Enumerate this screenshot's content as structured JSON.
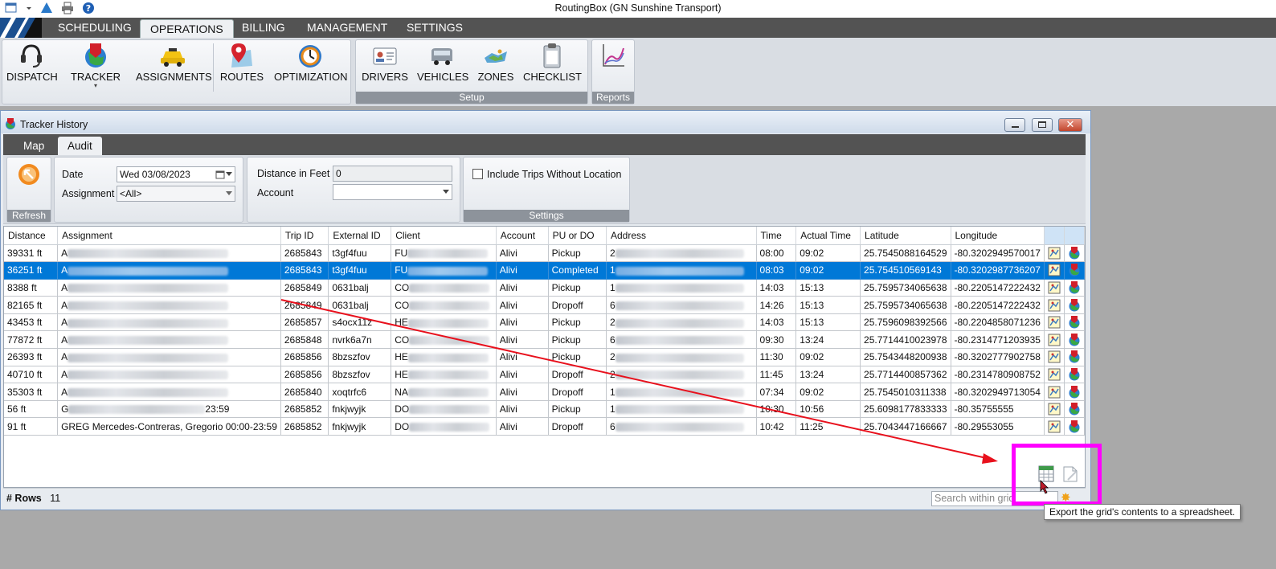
{
  "app": {
    "title": "RoutingBox (GN Sunshine Transport)"
  },
  "ribbon_tabs": [
    "SCHEDULING",
    "OPERATIONS",
    "BILLING",
    "MANAGEMENT",
    "SETTINGS"
  ],
  "ribbon": {
    "buttons": {
      "dispatch": "DISPATCH",
      "tracker": "TRACKER",
      "assignments": "ASSIGNMENTS",
      "routes": "ROUTES",
      "optimization": "OPTIMIZATION",
      "drivers": "DRIVERS",
      "vehicles": "VEHICLES",
      "zones": "ZONES",
      "checklist": "CHECKLIST"
    },
    "groups": {
      "setup": "Setup",
      "reports": "Reports"
    }
  },
  "window": {
    "title": "Tracker History",
    "tabs": [
      "Map",
      "Audit"
    ],
    "refresh_label": "Refresh",
    "settings_label": "Settings",
    "filters": {
      "date_label": "Date",
      "date_value": "Wed 03/08/2023",
      "assignment_label": "Assignment",
      "assignment_value": "<All>",
      "distance_label": "Distance in Feet",
      "distance_value": "0",
      "account_label": "Account",
      "account_value": "",
      "include_trips_label": "Include Trips Without Location"
    }
  },
  "grid": {
    "columns": [
      "Distance",
      "Assignment",
      "Trip ID",
      "External ID",
      "Client",
      "Account",
      "PU or DO",
      "Address",
      "Time",
      "Actual Time",
      "Latitude",
      "Longitude"
    ],
    "rows": [
      {
        "distance": "39331 ft",
        "assignment": "A",
        "trip_id": "2685843",
        "external_id": "t3gf4fuu",
        "client": "FU",
        "account": "Alivi",
        "pu_do": "Pickup",
        "address": "2",
        "time": "08:00",
        "actual_time": "09:02",
        "latitude": "25.7545088164529",
        "longitude": "-80.3202949570017"
      },
      {
        "distance": "36251 ft",
        "assignment": "A",
        "trip_id": "2685843",
        "external_id": "t3gf4fuu",
        "client": "FU",
        "account": "Alivi",
        "pu_do": "Completed",
        "address": "1",
        "time": "08:03",
        "actual_time": "09:02",
        "latitude": "25.754510569143",
        "longitude": "-80.3202987736207"
      },
      {
        "distance": "8388 ft",
        "assignment": "A",
        "trip_id": "2685849",
        "external_id": "0631balj",
        "client": "CO",
        "account": "Alivi",
        "pu_do": "Pickup",
        "address": "1",
        "time": "14:03",
        "actual_time": "15:13",
        "latitude": "25.7595734065638",
        "longitude": "-80.2205147222432"
      },
      {
        "distance": "82165 ft",
        "assignment": "A",
        "trip_id": "2685849",
        "external_id": "0631balj",
        "client": "CO",
        "account": "Alivi",
        "pu_do": "Dropoff",
        "address": "6",
        "time": "14:26",
        "actual_time": "15:13",
        "latitude": "25.7595734065638",
        "longitude": "-80.2205147222432"
      },
      {
        "distance": "43453 ft",
        "assignment": "A",
        "trip_id": "2685857",
        "external_id": "s4ocx11z",
        "client": "HE",
        "account": "Alivi",
        "pu_do": "Pickup",
        "address": "2",
        "time": "14:03",
        "actual_time": "15:13",
        "latitude": "25.7596098392566",
        "longitude": "-80.2204858071236"
      },
      {
        "distance": "77872 ft",
        "assignment": "A",
        "trip_id": "2685848",
        "external_id": "nvrk6a7n",
        "client": "CO",
        "account": "Alivi",
        "pu_do": "Pickup",
        "address": "6",
        "time": "09:30",
        "actual_time": "13:24",
        "latitude": "25.7714410023978",
        "longitude": "-80.2314771203935"
      },
      {
        "distance": "26393 ft",
        "assignment": "A",
        "trip_id": "2685856",
        "external_id": "8bzszfov",
        "client": "HE",
        "account": "Alivi",
        "pu_do": "Pickup",
        "address": "2",
        "time": "11:30",
        "actual_time": "09:02",
        "latitude": "25.7543448200938",
        "longitude": "-80.3202777902758"
      },
      {
        "distance": "40710 ft",
        "assignment": "A",
        "trip_id": "2685856",
        "external_id": "8bzszfov",
        "client": "HE",
        "account": "Alivi",
        "pu_do": "Dropoff",
        "address": "2",
        "time": "11:45",
        "actual_time": "13:24",
        "latitude": "25.7714400857362",
        "longitude": "-80.2314780908752"
      },
      {
        "distance": "35303 ft",
        "assignment": "A",
        "trip_id": "2685840",
        "external_id": "xoqtrfc6",
        "client": "NA",
        "account": "Alivi",
        "pu_do": "Dropoff",
        "address": "1",
        "time": "07:34",
        "actual_time": "09:02",
        "latitude": "25.7545010311338",
        "longitude": "-80.3202949713054"
      },
      {
        "distance": "56 ft",
        "assignment": "G",
        "assignment_suffix": "23:59",
        "trip_id": "2685852",
        "external_id": "fnkjwyjk",
        "client": "DO",
        "account": "Alivi",
        "pu_do": "Pickup",
        "address": "1",
        "time": "10:30",
        "actual_time": "10:56",
        "latitude": "25.6098177833333",
        "longitude": "-80.35755555"
      },
      {
        "distance": "91 ft",
        "assignment": "GREG Mercedes-Contreras, Gregorio 00:00-23:59",
        "trip_id": "2685852",
        "external_id": "fnkjwyjk",
        "client": "DO",
        "account": "Alivi",
        "pu_do": "Dropoff",
        "address": "6",
        "time": "10:42",
        "actual_time": "11:25",
        "latitude": "25.7043447166667",
        "longitude": "-80.29553055"
      }
    ],
    "selected_row": 1
  },
  "footer": {
    "rows_label": "# Rows",
    "rows_count": "11",
    "search_placeholder": "Search within grid"
  },
  "tooltip": {
    "text": "Export the grid's contents to a spreadsheet."
  },
  "colors": {
    "highlight": "#ff00ff",
    "arrow": "#e8101c",
    "selection": "#0078d7"
  }
}
